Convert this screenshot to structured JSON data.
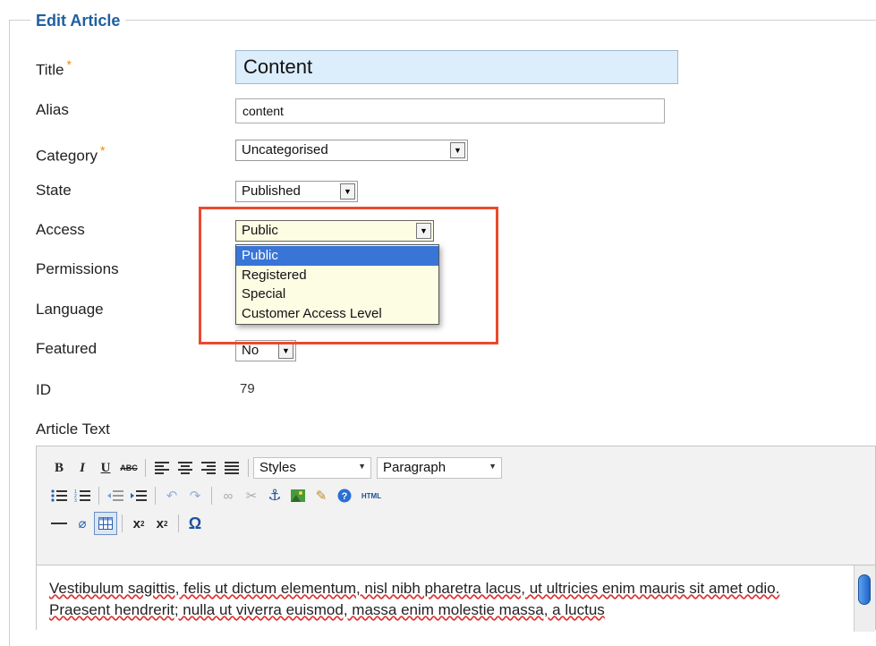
{
  "form": {
    "legend": "Edit Article",
    "required_marker": "*",
    "title_label": "Title",
    "title_value": "Content",
    "alias_label": "Alias",
    "alias_value": "content",
    "category_label": "Category",
    "category_value": "Uncategorised",
    "state_label": "State",
    "state_value": "Published",
    "access_label": "Access",
    "access_value": "Public",
    "access_options": [
      "Public",
      "Registered",
      "Special",
      "Customer Access Level"
    ],
    "permissions_label": "Permissions",
    "language_label": "Language",
    "featured_label": "Featured",
    "featured_value": "No",
    "id_label": "ID",
    "id_value": "79",
    "article_text_label": "Article Text"
  },
  "editor": {
    "styles_label": "Styles",
    "format_label": "Paragraph",
    "html_label": "HTML",
    "content": "Vestibulum sagittis, felis ut dictum elementum, nisl nibh pharetra lacus, ut ultricies enim mauris sit amet odio. Praesent hendrerit; nulla ut viverra euismod, massa enim molestie massa, a luctus"
  },
  "colors": {
    "legend": "#1f5fa0",
    "required": "#f08a00",
    "title_bg": "#dcedfb",
    "dropdown_bg": "#fdfde4",
    "selected_option": "#3875d7",
    "highlight_box": "#ea4a2e"
  }
}
